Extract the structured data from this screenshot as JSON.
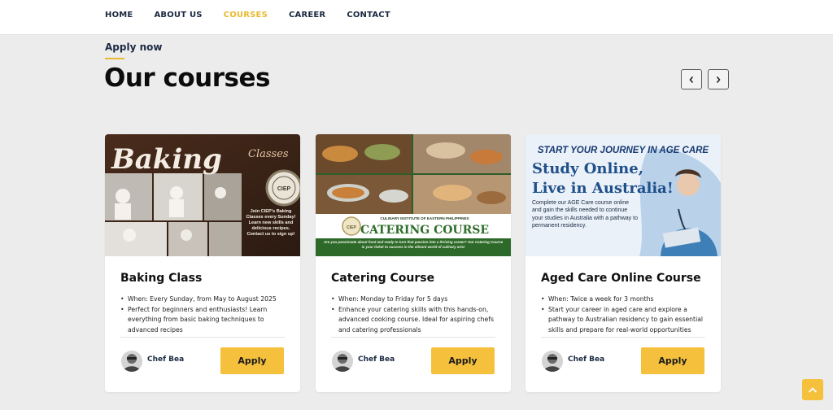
{
  "nav": {
    "items": [
      {
        "label": "HOME",
        "active": false
      },
      {
        "label": "ABOUT US",
        "active": false
      },
      {
        "label": "COURSES",
        "active": true
      },
      {
        "label": "CAREER",
        "active": false
      },
      {
        "label": "CONTACT",
        "active": false
      }
    ],
    "active_color": "#e9b92f"
  },
  "header": {
    "eyebrow": "Apply now",
    "title": "Our courses"
  },
  "carousel": {
    "prev_icon": "chevron-left-icon",
    "next_icon": "chevron-right-icon"
  },
  "cards": [
    {
      "title": "Baking Class",
      "image": {
        "script_title": "Baking",
        "script_sub": "Classes",
        "badge": "CIEP",
        "caption": "Join CIEP's Baking Classes every Sunday! Learn new skills and delicious recipes. Contact us to sign up!"
      },
      "bullets": [
        "When: Every Sunday, from May to August 2025",
        "Perfect for beginners and enthusiasts! Learn everything from basic baking techniques to advanced recipes"
      ],
      "author": "Chef Bea",
      "apply_label": "Apply"
    },
    {
      "title": "Catering Course",
      "image": {
        "institute": "CULINARY INSTITUTE OF EASTERN PHILIPPINES",
        "banner": "CATERING COURSE",
        "caption": "Are you passionate about food and ready to turn that passion into a thriving career? Our Catering Course is your ticket to success in the vibrant world of culinary arts!"
      },
      "bullets": [
        "When: Monday to Friday for 5 days",
        "Enhance your catering skills with this hands-on, advanced cooking course. Ideal for aspiring chefs and catering professionals"
      ],
      "author": "Chef Bea",
      "apply_label": "Apply"
    },
    {
      "title": "Aged Care Online Course",
      "image": {
        "headline": "START YOUR JOURNEY IN AGE CARE",
        "line1": "Study Online,",
        "line2": "Live in Australia!",
        "body": "Complete our AGE Care course online and gain the skills needed to continue your studies in Australia with a pathway to permanent residency."
      },
      "bullets": [
        "When: Twice a week for 3 months",
        "Start your career in aged care and explore a pathway to Australian residency to gain essential skills and prepare for real-world opportunities"
      ],
      "author": "Chef Bea",
      "apply_label": "Apply"
    }
  ],
  "back_to_top_icon": "chevron-up-icon",
  "accent_color": "#f5c13c"
}
